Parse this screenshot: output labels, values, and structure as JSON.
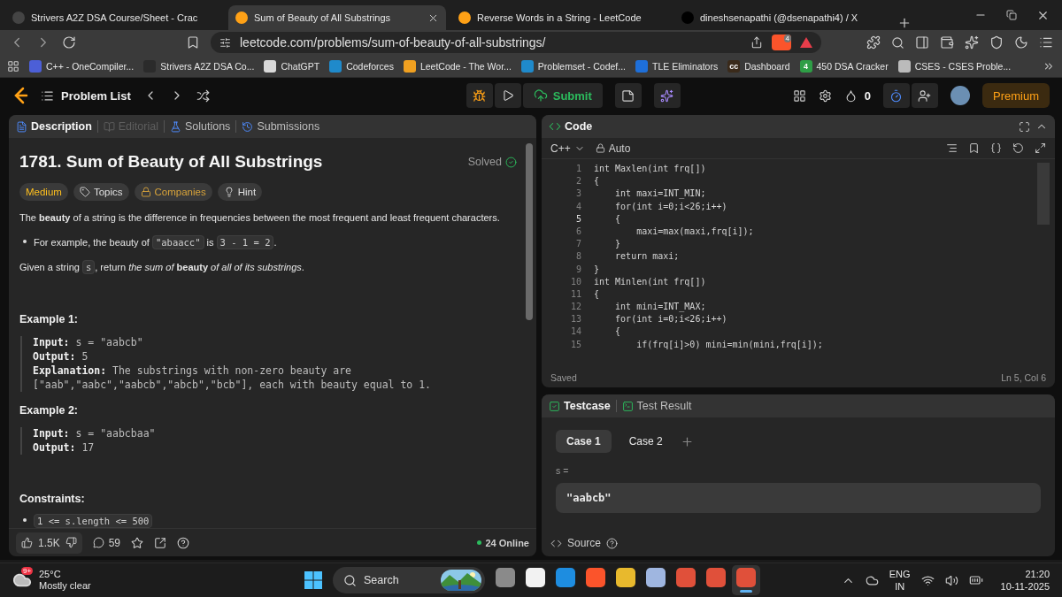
{
  "browser_tabs": [
    {
      "title": "Strivers A2Z DSA Course/Sheet - Crac",
      "selected": false
    },
    {
      "title": "Sum of Beauty of All Substrings",
      "selected": true
    },
    {
      "title": "Reverse Words in a String - LeetCode",
      "selected": false
    },
    {
      "title": "dineshsenapathi (@dsenapathi4) / X",
      "selected": false
    }
  ],
  "address_bar": {
    "url": "leetcode.com/problems/sum-of-beauty-of-all-substrings/",
    "shield_badge": "4"
  },
  "bookmarks": [
    {
      "label": "C++ - OneCompiler...",
      "color": "#4c5fd7"
    },
    {
      "label": "Strivers A2Z DSA Co...",
      "color": "#2b2b2b"
    },
    {
      "label": "ChatGPT",
      "color": "#d9d9d9"
    },
    {
      "label": "Codeforces",
      "color": "#1f8acb"
    },
    {
      "label": "LeetCode - The Wor...",
      "color": "#f0a020"
    },
    {
      "label": "Problemset - Codef...",
      "color": "#1f8acb"
    },
    {
      "label": "TLE Eliminators",
      "color": "#1e6fd9"
    },
    {
      "label": "Dashboard",
      "color": "#3a2a1a",
      "badge": "cc"
    },
    {
      "label": "450 DSA Cracker",
      "color": "#2e9e46",
      "badge": "4"
    },
    {
      "label": "CSES - CSES Proble...",
      "color": "#bbbbbb"
    }
  ],
  "nav": {
    "problem_list": "Problem List",
    "submit": "Submit",
    "streak": "0",
    "premium": "Premium"
  },
  "description": {
    "tabs": [
      {
        "label": "Description",
        "selected": true,
        "disabled": false
      },
      {
        "label": "Editorial",
        "selected": false,
        "disabled": true
      },
      {
        "label": "Solutions",
        "selected": false,
        "disabled": false
      },
      {
        "label": "Submissions",
        "selected": false,
        "disabled": false
      }
    ],
    "title": "1781. Sum of Beauty of All Substrings",
    "status": "Solved",
    "tags": [
      {
        "label": "Medium",
        "kind": "difficulty"
      },
      {
        "label": "Topics",
        "kind": "topics"
      },
      {
        "label": "Companies",
        "kind": "companies"
      },
      {
        "label": "Hint",
        "kind": "hint"
      }
    ],
    "blocks": [
      {
        "kind": "para",
        "parts": [
          {
            "kind": "text",
            "text": "The **beauty** of a string is the difference in frequencies between the most frequent and least frequent characters."
          }
        ]
      },
      {
        "kind": "bullet",
        "parts": [
          {
            "kind": "text",
            "text": "For example, the beauty of "
          },
          {
            "kind": "code",
            "text": "\"abaacc\""
          },
          {
            "kind": "text",
            "text": " is "
          },
          {
            "kind": "code",
            "text": "3 - 1 = 2"
          },
          {
            "kind": "text",
            "text": "."
          }
        ]
      },
      {
        "kind": "para",
        "parts": [
          {
            "kind": "text",
            "text": "Given a string "
          },
          {
            "kind": "code",
            "text": "s"
          },
          {
            "kind": "text",
            "text": ", return *the sum of* **beauty** *of all of its substrings*."
          }
        ]
      }
    ],
    "examples": [
      {
        "title": "Example 1:",
        "lines": [
          "**Input:** s = \"aabcb\"",
          "**Output:** 5",
          "**Explanation:** The substrings with non-zero beauty are",
          "[\"aab\",\"aabc\",\"aabcb\",\"abcb\",\"bcb\"], each with beauty equal to 1."
        ]
      },
      {
        "title": "Example 2:",
        "lines": [
          "**Input:** s = \"aabcbaa\"",
          "**Output:** 17"
        ]
      }
    ],
    "constraints": {
      "title": "Constraints:",
      "items": [
        "1 <= s.length <= 500"
      ]
    },
    "footer": {
      "likes": "1.5K",
      "comments": "59",
      "online": "24 Online"
    }
  },
  "code": {
    "title": "Code",
    "language": "C++",
    "mode": "Auto",
    "lines": [
      {
        "no": "1",
        "text": "int Maxlen(int frq[])",
        "current": false
      },
      {
        "no": "2",
        "text": "{",
        "current": false
      },
      {
        "no": "3",
        "text": "    int maxi=INT_MIN;",
        "current": false
      },
      {
        "no": "4",
        "text": "    for(int i=0;i<26;i++)",
        "current": false
      },
      {
        "no": "5",
        "text": "    {",
        "current": true
      },
      {
        "no": "6",
        "text": "        maxi=max(maxi,frq[i]);",
        "current": false
      },
      {
        "no": "7",
        "text": "    }",
        "current": false
      },
      {
        "no": "8",
        "text": "    return maxi;",
        "current": false
      },
      {
        "no": "9",
        "text": "}",
        "current": false
      },
      {
        "no": "10",
        "text": "int Minlen(int frq[])",
        "current": false
      },
      {
        "no": "11",
        "text": "{",
        "current": false
      },
      {
        "no": "12",
        "text": "    int mini=INT_MAX;",
        "current": false
      },
      {
        "no": "13",
        "text": "    for(int i=0;i<26;i++)",
        "current": false
      },
      {
        "no": "14",
        "text": "    {",
        "current": false
      },
      {
        "no": "15",
        "text": "        if(frq[i]>0) mini=min(mini,frq[i]);",
        "current": false
      }
    ],
    "saved": "Saved",
    "cursor": "Ln 5, Col 6"
  },
  "testcase": {
    "tabs": [
      {
        "label": "Testcase",
        "selected": true
      },
      {
        "label": "Test Result",
        "selected": false
      }
    ],
    "cases": [
      {
        "label": "Case 1",
        "selected": true
      },
      {
        "label": "Case 2",
        "selected": false
      }
    ],
    "var_label": "s =",
    "value": "\"aabcb\"",
    "source": "Source"
  },
  "taskbar": {
    "weather": {
      "badge": "9+",
      "temp": "25°C",
      "condition": "Mostly clear"
    },
    "search": "Search",
    "apps": [
      {
        "kind": "taskview",
        "active": false
      },
      {
        "kind": "store",
        "active": false
      },
      {
        "kind": "edge",
        "active": false
      },
      {
        "kind": "brave",
        "active": false
      },
      {
        "kind": "chrome",
        "active": false
      },
      {
        "kind": "keyboard",
        "active": false
      },
      {
        "kind": "profile",
        "active": false
      },
      {
        "kind": "profile",
        "active": false
      },
      {
        "kind": "profile",
        "active": true
      }
    ],
    "lang": "ENG",
    "region": "IN",
    "time": "21:20",
    "date": "10-11-2025"
  }
}
